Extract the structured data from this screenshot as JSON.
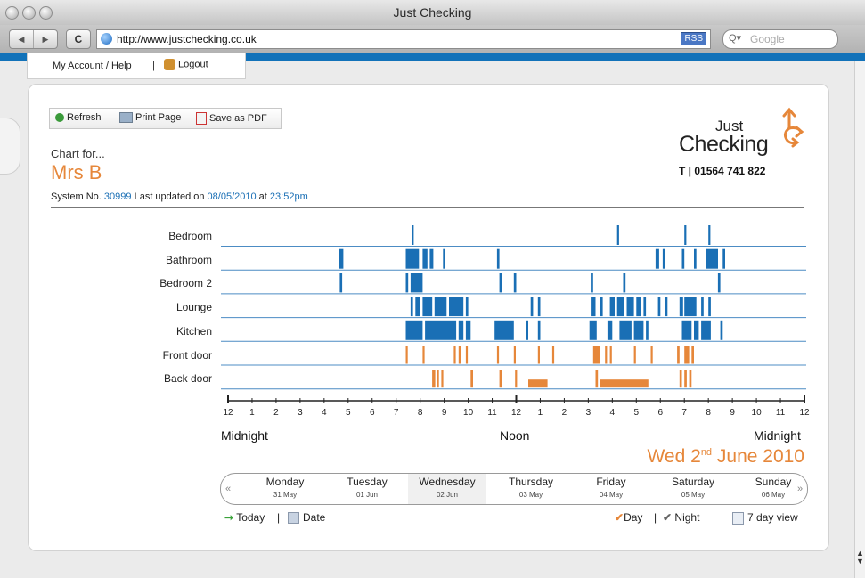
{
  "window": {
    "title": "Just Checking"
  },
  "browser": {
    "url": "http://www.justchecking.co.uk",
    "rss_label": "RSS",
    "search_placeholder": "Google"
  },
  "account": {
    "help_label": "My Account / Help",
    "separator": "|",
    "logout_label": "Logout"
  },
  "actions": {
    "refresh": "Refresh",
    "print": "Print Page",
    "pdf": "Save as PDF"
  },
  "header": {
    "chart_for": "Chart for...",
    "person": "Mrs B",
    "system_prefix": "System No.",
    "system_no": "30999",
    "updated_prefix": "Last updated on",
    "updated_date": "08/05/2010",
    "at": "at",
    "updated_time": "23:52pm"
  },
  "logo": {
    "line1": "Just",
    "line2": "Checking",
    "phone": "T | 01564 741 822"
  },
  "colors": {
    "activity_blue": "#1a6fb5",
    "door_orange": "#e6873a"
  },
  "chart_data": {
    "type": "timeline",
    "x_unit": "hour_of_day",
    "xlim": [
      0,
      24
    ],
    "tick_labels": [
      "12",
      "1",
      "2",
      "3",
      "4",
      "5",
      "6",
      "7",
      "8",
      "9",
      "10",
      "11",
      "12",
      "1",
      "2",
      "3",
      "4",
      "5",
      "6",
      "7",
      "8",
      "9",
      "10",
      "11",
      "12"
    ],
    "time_labels": {
      "left": "Midnight",
      "center": "Noon",
      "right": "Midnight"
    },
    "date": "Wed 2nd June 2010",
    "sensors": [
      {
        "name": "Bedroom",
        "kind": "room",
        "events": [
          [
            7.64,
            7.73
          ],
          [
            16.2,
            16.28
          ],
          [
            19.0,
            19.08
          ],
          [
            20.0,
            20.08
          ]
        ]
      },
      {
        "name": "Bathroom",
        "kind": "room",
        "events": [
          [
            4.6,
            4.8
          ],
          [
            7.4,
            7.95
          ],
          [
            8.1,
            8.3
          ],
          [
            8.4,
            8.55
          ],
          [
            8.95,
            9.05
          ],
          [
            11.2,
            11.3
          ],
          [
            17.8,
            17.95
          ],
          [
            18.1,
            18.2
          ],
          [
            18.9,
            19.0
          ],
          [
            19.4,
            19.5
          ],
          [
            19.9,
            20.4
          ],
          [
            20.6,
            20.7
          ]
        ]
      },
      {
        "name": "Bedroom 2",
        "kind": "room",
        "events": [
          [
            4.65,
            4.75
          ],
          [
            7.4,
            7.5
          ],
          [
            7.6,
            8.1
          ],
          [
            11.3,
            11.4
          ],
          [
            11.9,
            12.0
          ],
          [
            15.1,
            15.2
          ],
          [
            16.45,
            16.55
          ],
          [
            20.4,
            20.5
          ]
        ]
      },
      {
        "name": "Lounge",
        "kind": "room",
        "events": [
          [
            7.6,
            7.7
          ],
          [
            7.8,
            8.0
          ],
          [
            8.1,
            8.5
          ],
          [
            8.6,
            9.1
          ],
          [
            9.2,
            9.8
          ],
          [
            9.9,
            10.0
          ],
          [
            12.6,
            12.7
          ],
          [
            12.9,
            13.0
          ],
          [
            15.1,
            15.3
          ],
          [
            15.5,
            15.6
          ],
          [
            15.9,
            16.1
          ],
          [
            16.2,
            16.5
          ],
          [
            16.6,
            16.9
          ],
          [
            17.0,
            17.2
          ],
          [
            17.3,
            17.4
          ],
          [
            17.9,
            18.0
          ],
          [
            18.2,
            18.3
          ],
          [
            18.8,
            18.95
          ],
          [
            19.0,
            19.5
          ],
          [
            19.7,
            19.8
          ],
          [
            20.0,
            20.1
          ]
        ]
      },
      {
        "name": "Kitchen",
        "kind": "room",
        "events": [
          [
            7.4,
            8.1
          ],
          [
            8.2,
            9.5
          ],
          [
            9.6,
            9.8
          ],
          [
            9.9,
            10.1
          ],
          [
            11.1,
            11.9
          ],
          [
            12.4,
            12.5
          ],
          [
            12.9,
            13.0
          ],
          [
            15.05,
            15.35
          ],
          [
            15.8,
            16.0
          ],
          [
            16.3,
            16.8
          ],
          [
            16.9,
            17.3
          ],
          [
            17.4,
            17.5
          ],
          [
            18.9,
            19.3
          ],
          [
            19.4,
            19.6
          ],
          [
            19.7,
            20.1
          ],
          [
            20.5,
            20.6
          ]
        ]
      },
      {
        "name": "Front door",
        "kind": "door",
        "events": [
          [
            7.4,
            7.48
          ],
          [
            8.1,
            8.18
          ],
          [
            9.4,
            9.48
          ],
          [
            9.6,
            9.7
          ],
          [
            9.9,
            9.98
          ],
          [
            11.2,
            11.28
          ],
          [
            11.9,
            11.98
          ],
          [
            12.9,
            12.98
          ],
          [
            13.5,
            13.58
          ],
          [
            15.2,
            15.5
          ],
          [
            15.7,
            15.78
          ],
          [
            15.9,
            15.98
          ],
          [
            16.9,
            16.98
          ],
          [
            17.6,
            17.68
          ],
          [
            18.7,
            18.8
          ],
          [
            19.0,
            19.2
          ],
          [
            19.3,
            19.4
          ]
        ]
      },
      {
        "name": "Back door",
        "kind": "door",
        "events": [
          [
            8.5,
            8.63
          ],
          [
            8.7,
            8.78
          ],
          [
            8.88,
            8.96
          ],
          [
            10.1,
            10.2
          ],
          [
            11.3,
            11.4
          ],
          [
            11.95,
            12.03
          ],
          [
            12.5,
            13.3
          ],
          [
            15.3,
            15.4
          ],
          [
            15.5,
            17.5
          ],
          [
            18.8,
            18.9
          ],
          [
            19.0,
            19.1
          ],
          [
            19.2,
            19.3
          ]
        ]
      }
    ]
  },
  "week": {
    "prev": "«",
    "next": "»",
    "days": [
      {
        "name": "Monday",
        "date": "31 May"
      },
      {
        "name": "Tuesday",
        "date": "01 Jun"
      },
      {
        "name": "Wednesday",
        "date": "02 Jun"
      },
      {
        "name": "Thursday",
        "date": "03 May"
      },
      {
        "name": "Friday",
        "date": "04 May"
      },
      {
        "name": "Saturday",
        "date": "05 May"
      },
      {
        "name": "Sunday",
        "date": "06 May"
      }
    ]
  },
  "footer": {
    "today": "Today",
    "sep1": "|",
    "date": "Date",
    "day": "Day",
    "sep2": "|",
    "night": "Night",
    "seven_day": "7 day view"
  }
}
